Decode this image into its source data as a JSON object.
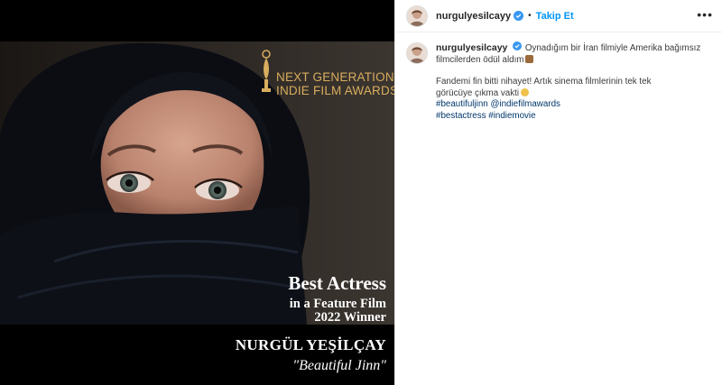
{
  "colors": {
    "accent": "#0095f6",
    "hashtag": "#00376b",
    "award_gold": "#d8ad5e",
    "verified": "#3897f0"
  },
  "media": {
    "award_logo": [
      "NEXT GENERATION",
      "INDIE FILM AWARDS"
    ],
    "award_title": "Best Actress",
    "award_category": "in a Feature Film",
    "award_year": "2022 Winner",
    "actress_name": "NURGÜL YEŞİLÇAY",
    "film_title": "\"Beautiful Jinn\""
  },
  "header": {
    "username": "nurgulyesilcayy",
    "separator": "•",
    "follow_label": "Takip Et",
    "more_icon": "ellipsis-icon"
  },
  "caption": {
    "username": "nurgulyesilcayy",
    "line1": "Oynadığım bir İran filmiyle Amerika bağımsız",
    "line2": "filmcilerden ödül aldım",
    "line3": "Fandemi fin bitti nihayet! Artık sinema filmlerinin tek tek",
    "line4": "görücüye çıkma vakti",
    "tags_line1": "#beautifuljinn @indiefilmawards",
    "tags_line2": "#bestactress #indiemovie"
  }
}
